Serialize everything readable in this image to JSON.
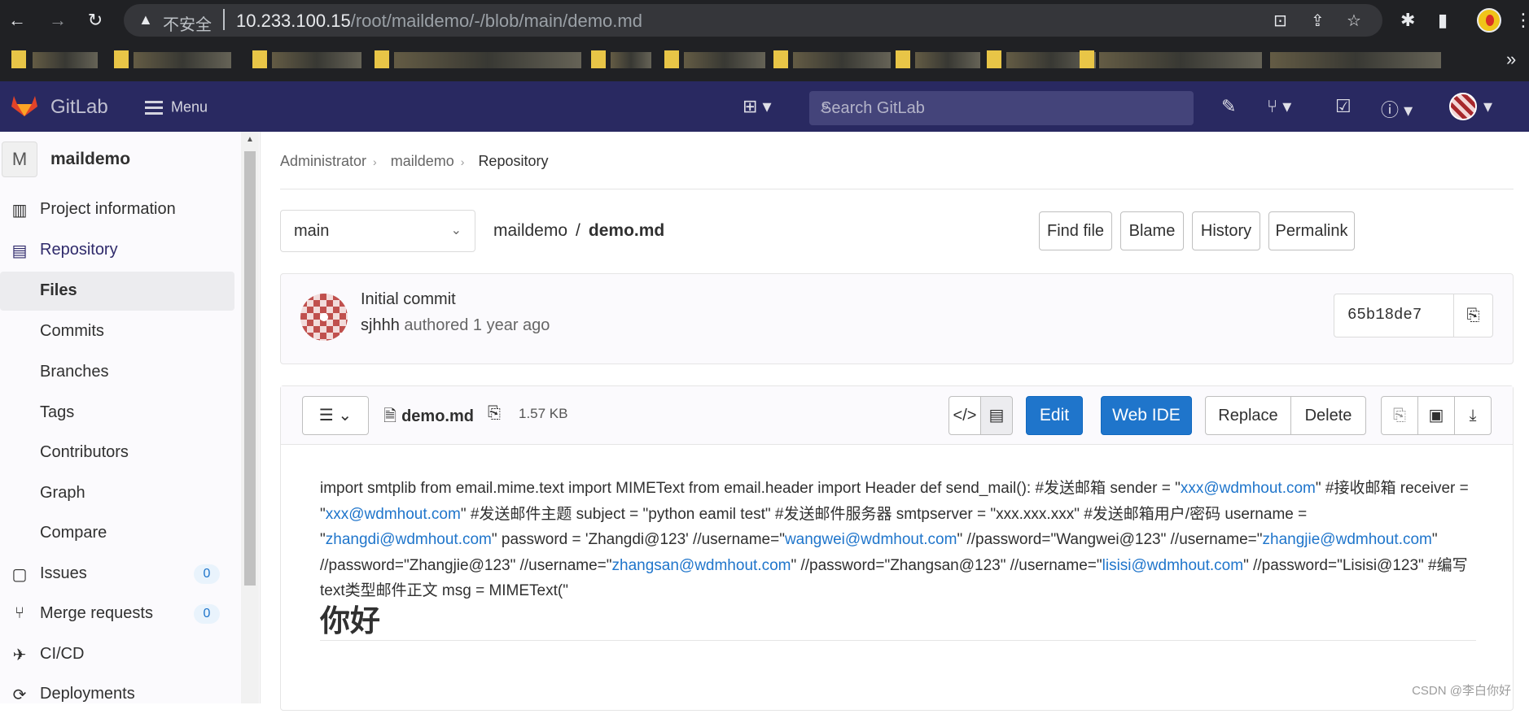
{
  "browser": {
    "insecure_label": "不安全",
    "url_host": "10.233.100.15",
    "url_path": "/root/maildemo/-/blob/main/demo.md"
  },
  "gitlab_nav": {
    "brand": "GitLab",
    "menu_label": "Menu",
    "search_placeholder": "Search GitLab"
  },
  "sidebar": {
    "project_initial": "M",
    "project_name": "maildemo",
    "items": [
      {
        "label": "Project information",
        "icon": "book-icon"
      },
      {
        "label": "Repository",
        "icon": "document-icon"
      },
      {
        "label": "Files"
      },
      {
        "label": "Commits"
      },
      {
        "label": "Branches"
      },
      {
        "label": "Tags"
      },
      {
        "label": "Contributors"
      },
      {
        "label": "Graph"
      },
      {
        "label": "Compare"
      },
      {
        "label": "Issues",
        "icon": "issues-icon",
        "count": "0"
      },
      {
        "label": "Merge requests",
        "icon": "merge-request-icon",
        "count": "0"
      },
      {
        "label": "CI/CD",
        "icon": "rocket-icon"
      },
      {
        "label": "Deployments",
        "icon": "deploy-icon"
      }
    ]
  },
  "breadcrumb": [
    "Administrator",
    "maildemo",
    "Repository"
  ],
  "toolbar": {
    "branch": "main",
    "path_root": "maildemo",
    "path_sep": "/",
    "path_file": "demo.md",
    "find_file": "Find file",
    "blame": "Blame",
    "history": "History",
    "permalink": "Permalink"
  },
  "commit": {
    "title": "Initial commit",
    "author": "sjhhh",
    "meta": "authored 1 year ago",
    "sha": "65b18de7"
  },
  "file": {
    "name": "demo.md",
    "size": "1.57 KB",
    "edit": "Edit",
    "web_ide": "Web IDE",
    "replace": "Replace",
    "delete": "Delete"
  },
  "content": {
    "t1": "import smtplib from email.mime.text import MIMEText from email.header import Header def send_mail(): #发送邮箱 sender = \"",
    "l1": "xxx@wdmhout.com",
    "t2": "\" #接收邮箱 receiver = \"",
    "l2": "xxx@wdmhout.com",
    "t3": "\" #发送邮件主题 subject = \"python eamil test\" #发送邮件服务器 smtpserver = \"xxx.xxx.xxx\" #发送邮箱用户/密码 username = \"",
    "l3": "zhangdi@wdmhout.com",
    "t4": "\" password = 'Zhangdi@123' //username=\"",
    "l4": "wangwei@wdmhout.com",
    "t5": "\" //password=\"Wangwei@123\" //username=\"",
    "l5": "zhangjie@wdmhout.com",
    "t6": "\" //password=\"Zhangjie@123\" //username=\"",
    "l6": "zhangsan@wdmhout.com",
    "t7": "\" //password=\"Zhangsan@123\" //username=\"",
    "l7": "lisisi@wdmhout.com",
    "t8": "\" //password=\"Lisisi@123\" #编写text类型邮件正文 msg = MIMEText(\"",
    "heading": "你好"
  },
  "watermark": "CSDN @李白你好"
}
